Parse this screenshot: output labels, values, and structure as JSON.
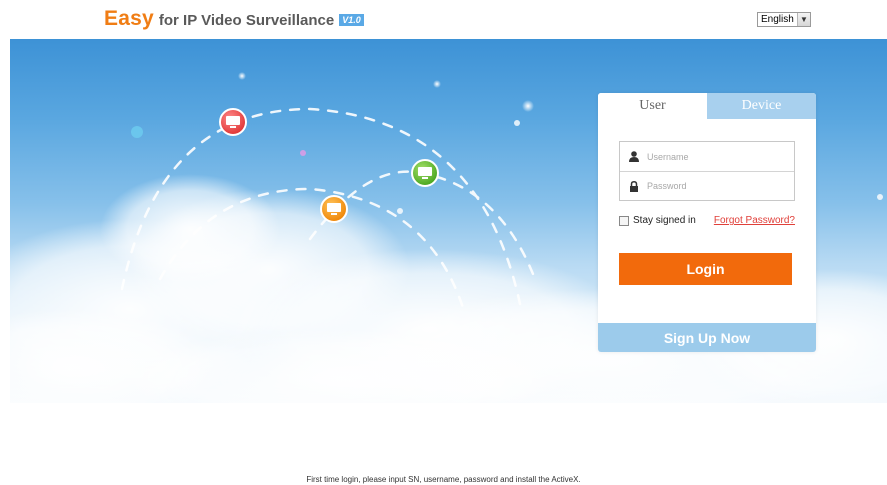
{
  "header": {
    "logo_easy": "Easy",
    "logo_rest": "for IP Video Surveillance",
    "version_badge": "V1.0",
    "language": "English"
  },
  "login_panel": {
    "tabs": [
      {
        "label": "User",
        "active": true
      },
      {
        "label": "Device",
        "active": false
      }
    ],
    "username_placeholder": "Username",
    "password_placeholder": "Password",
    "stay_signed_in": "Stay signed in",
    "forgot_password": "Forgot Password?",
    "login_button": "Login",
    "signup_button": "Sign Up Now"
  },
  "footer": {
    "note": "First time login, please input SN, username, password and install the ActiveX."
  },
  "colors": {
    "brand_orange": "#f26a0c",
    "logo_orange": "#f07d14",
    "tab_blue": "#a8d0ee",
    "signup_blue": "#9ccbeb",
    "link_red": "#e0403a"
  },
  "icons": {
    "username": "user-icon",
    "password": "lock-icon",
    "language_dropdown": "chevron-down-icon",
    "network_nodes": [
      "monitor-icon-red",
      "monitor-icon-green",
      "monitor-icon-orange"
    ]
  }
}
